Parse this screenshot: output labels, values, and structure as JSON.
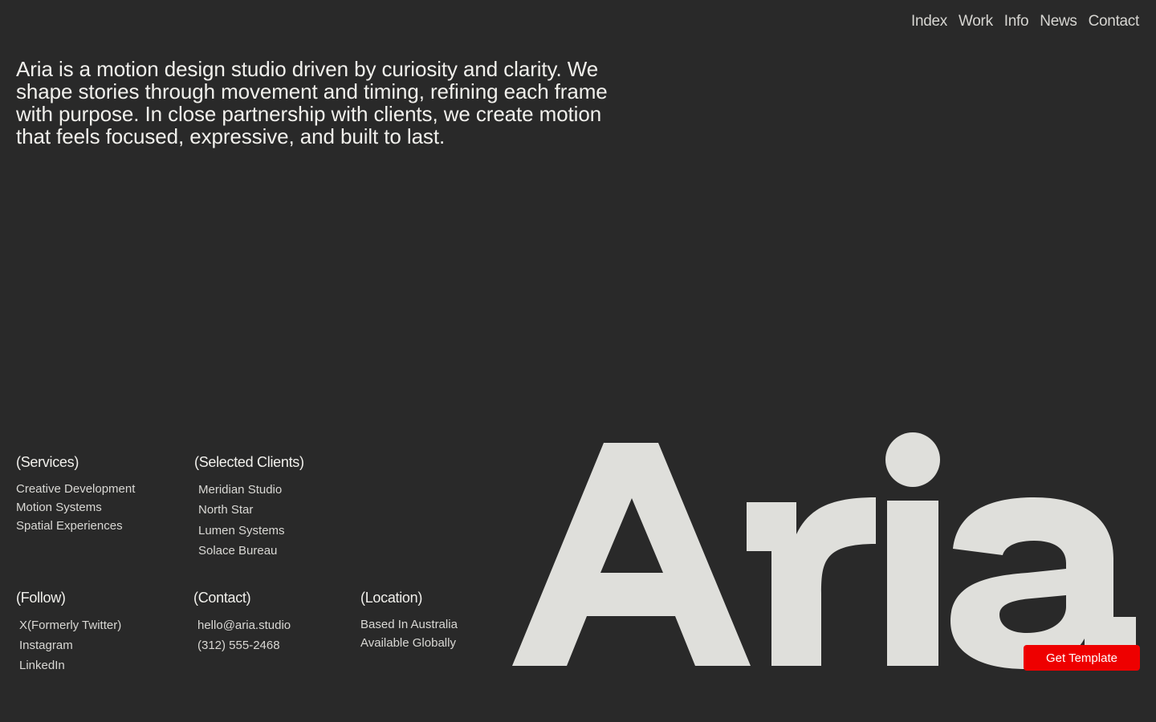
{
  "nav": {
    "items": [
      "Index",
      "Work",
      "Info",
      "News",
      "Contact"
    ]
  },
  "intro": {
    "text": "Aria is a motion design studio driven by curiosity and clarity. We shape stories through movement and timing, refining each frame with purpose. In close partnership with clients, we create motion that feels focused, expressive, and built to last."
  },
  "services": {
    "heading": "(Services)",
    "items": [
      "Creative Development",
      "Motion Systems",
      "Spatial Experiences"
    ]
  },
  "clients": {
    "heading": "(Selected Clients)",
    "items": [
      "Meridian Studio",
      "North Star",
      "Lumen Systems",
      "Solace Bureau"
    ]
  },
  "follow": {
    "heading": "(Follow)",
    "items": [
      "X(Formerly Twitter)",
      "Instagram",
      "LinkedIn"
    ]
  },
  "contact": {
    "heading": "(Contact)",
    "items": [
      "hello@aria.studio",
      "(312) 555-2468"
    ]
  },
  "location": {
    "heading": "(Location)",
    "items": [
      "Based In Australia",
      "Available Globally"
    ]
  },
  "wordmark": {
    "text": "Aria",
    "color": "#dfdfdb"
  },
  "cta": {
    "label": "Get Template",
    "color": "#ee0000"
  },
  "colors": {
    "background": "#292929",
    "text": "#f1f0ec"
  }
}
